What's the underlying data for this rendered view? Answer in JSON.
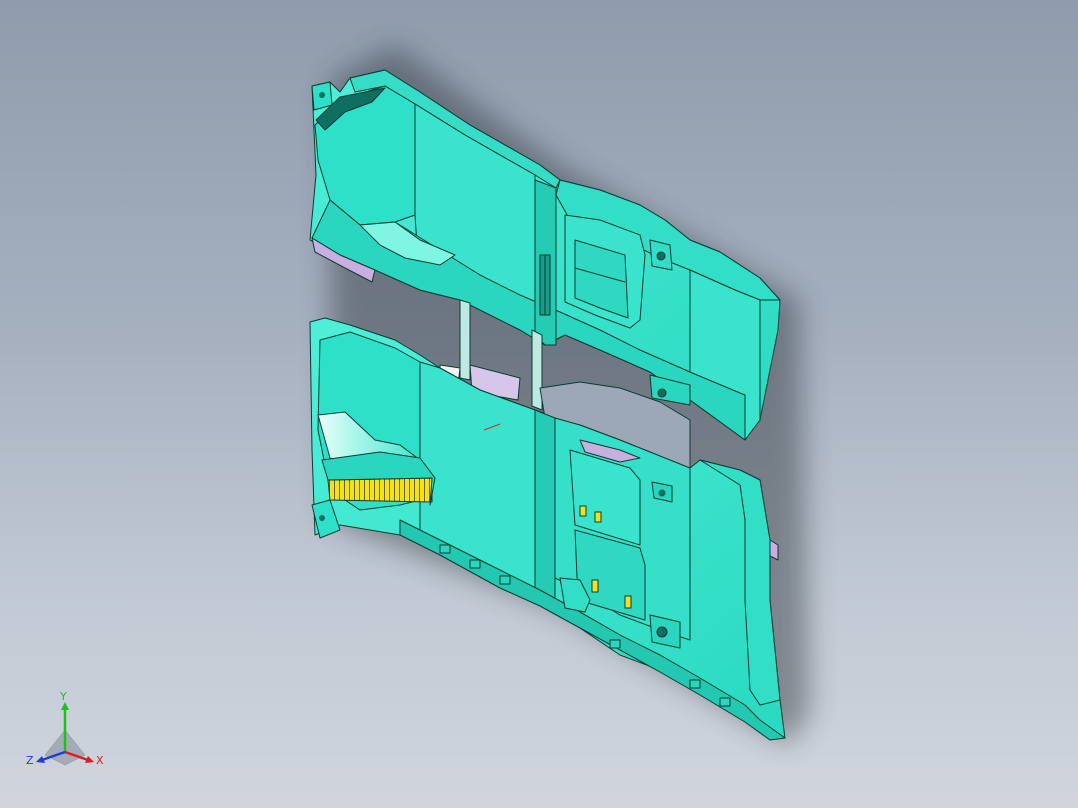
{
  "viewport": {
    "background_top": "#8e9cad",
    "background_bottom": "#d0d5de"
  },
  "model": {
    "part_color": "#33e6cc",
    "part_light": "#5ff0da",
    "part_dark": "#1fb8a3",
    "edge_color": "#0c3a34",
    "accent_pink": "#c9aee0",
    "accent_yellow": "#f2e21c"
  },
  "triad": {
    "x_label": "X",
    "y_label": "Y",
    "z_label": "Z",
    "x_color": "#e01c1c",
    "y_color": "#1cc21c",
    "z_color": "#1c3fd6"
  }
}
